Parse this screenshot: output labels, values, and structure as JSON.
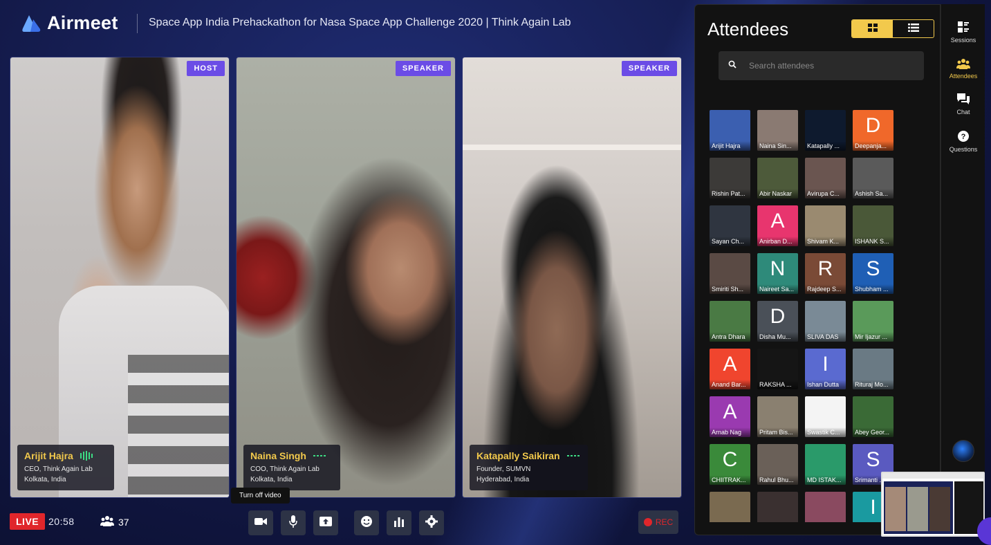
{
  "app": {
    "name": "Airmeet"
  },
  "event": {
    "title": "Space App India Prehackathon for Nasa Space App Challenge 2020 | Think Again Lab"
  },
  "speakers": [
    {
      "role": "HOST",
      "name": "Arijit Hajra",
      "title": "CEO, Think Again Lab",
      "location": "Kolkata, India"
    },
    {
      "role": "SPEAKER",
      "name": "Naina Singh",
      "title": "COO, Think Again Lab",
      "location": "Kolkata, India"
    },
    {
      "role": "SPEAKER",
      "name": "Katapally Saikiran",
      "title": "Founder, SUMVN",
      "location": "Hyderabad, India"
    }
  ],
  "stage_controls": {
    "live_label": "LIVE",
    "timer": "20:58",
    "people_count": "37",
    "tooltip": "Turn off video",
    "rec_label": "REC"
  },
  "attendees_panel": {
    "title": "Attendees",
    "search_placeholder": "Search attendees",
    "items": [
      {
        "name": "Arijit Hajra",
        "letter": "",
        "color": "#3b5fb0"
      },
      {
        "name": "Naina Sin...",
        "letter": "",
        "color": "#8a7a72"
      },
      {
        "name": "Katapally ...",
        "letter": "",
        "color": "#0e1a2e"
      },
      {
        "name": "Deepanja...",
        "letter": "D",
        "color": "#f0682a"
      },
      {
        "name": "Rishin Pat...",
        "letter": "",
        "color": "#3c3a38"
      },
      {
        "name": "Abir Naskar",
        "letter": "",
        "color": "#4d5a3a"
      },
      {
        "name": "Avirupa C...",
        "letter": "",
        "color": "#6a5550"
      },
      {
        "name": "Ashish Sa...",
        "letter": "",
        "color": "#5a5a5a"
      },
      {
        "name": "Sayan Ch...",
        "letter": "",
        "color": "#2f3540"
      },
      {
        "name": "Anirban D...",
        "letter": "A",
        "color": "#e8356e"
      },
      {
        "name": "Shivam K...",
        "letter": "",
        "color": "#9a8a70"
      },
      {
        "name": "ISHANK S...",
        "letter": "",
        "color": "#4a5838"
      },
      {
        "name": "Smiriti Sh...",
        "letter": "",
        "color": "#5a4a44"
      },
      {
        "name": "Naireet Sa...",
        "letter": "N",
        "color": "#2e8a7a"
      },
      {
        "name": "Rajdeep S...",
        "letter": "R",
        "color": "#7a4a36"
      },
      {
        "name": "Shubham ...",
        "letter": "S",
        "color": "#1f5fb5"
      },
      {
        "name": "Antra Dhara",
        "letter": "",
        "color": "#4a7a44"
      },
      {
        "name": "Disha Mu...",
        "letter": "D",
        "color": "#4a5058"
      },
      {
        "name": "SLIVA DAS",
        "letter": "",
        "color": "#7a8a96"
      },
      {
        "name": "Mir Ijazur ...",
        "letter": "",
        "color": "#5a9a5a"
      },
      {
        "name": "Anand Bar...",
        "letter": "A",
        "color": "#f0452e"
      },
      {
        "name": "RAKSHA ...",
        "letter": "",
        "color": "#151515"
      },
      {
        "name": "Ishan Dutta",
        "letter": "I",
        "color": "#5a6ad0"
      },
      {
        "name": "Rituraj Mo...",
        "letter": "",
        "color": "#6a7a84"
      },
      {
        "name": "Arnab Nag",
        "letter": "A",
        "color": "#9a3ab0"
      },
      {
        "name": "Pritam Bis...",
        "letter": "",
        "color": "#8a8070"
      },
      {
        "name": "Swastik C...",
        "letter": "",
        "color": "#f4f4f4"
      },
      {
        "name": "Abey Geor...",
        "letter": "",
        "color": "#3a6a36"
      },
      {
        "name": "CHIITRAK...",
        "letter": "C",
        "color": "#3a8a3a"
      },
      {
        "name": "Rahul Bhu...",
        "letter": "",
        "color": "#6a6058"
      },
      {
        "name": "MD ISTAK...",
        "letter": "",
        "color": "#2a9a6a"
      },
      {
        "name": "Srimanti ...",
        "letter": "S",
        "color": "#5a5ac0"
      },
      {
        "name": "",
        "letter": "",
        "color": "#7a6a50"
      },
      {
        "name": "",
        "letter": "",
        "color": "#3a3030"
      },
      {
        "name": "",
        "letter": "",
        "color": "#8a4a60"
      },
      {
        "name": "",
        "letter": "I",
        "color": "#1a9aa0"
      }
    ]
  },
  "rail": {
    "sessions": "Sessions",
    "attendees": "Attendees",
    "chat": "Chat",
    "questions": "Questions"
  },
  "colors": {
    "accent": "#f2c94c",
    "live": "#e0262b",
    "badge": "#6b4ce6"
  }
}
